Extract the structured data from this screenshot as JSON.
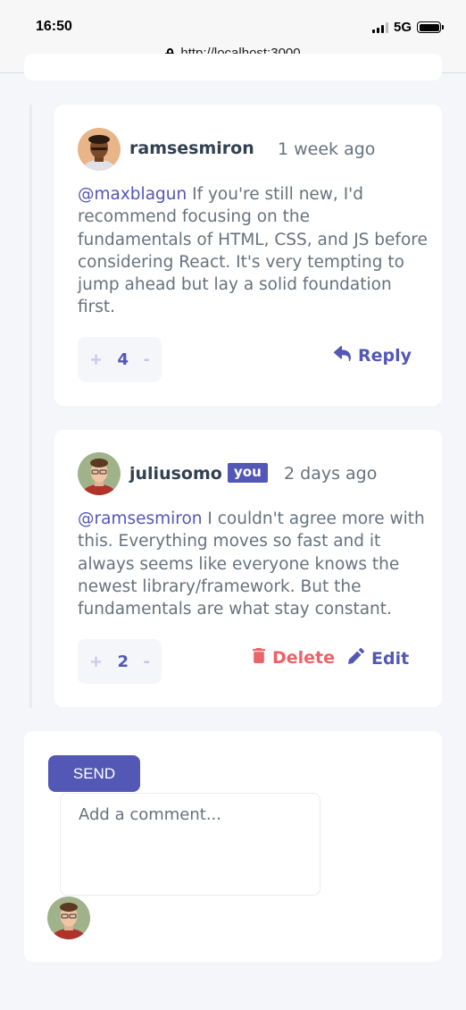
{
  "status_bar": {
    "time": "16:50",
    "network": "5G"
  },
  "browser": {
    "url": "http://localhost:3000"
  },
  "comments": [
    {
      "username": "ramsesmiron",
      "timestamp": "1 week ago",
      "mention": "@maxblagun",
      "text": " If you're still new, I'd recommend focusing on the fundamentals of HTML, CSS, and JS before considering React. It's very tempting to jump ahead but lay a solid foundation first.",
      "score": "4",
      "plus": "+",
      "minus": "-",
      "action_label": "Reply"
    },
    {
      "username": "juliusomo",
      "badge": "you",
      "timestamp": "2 days ago",
      "mention": "@ramsesmiron",
      "text": " I couldn't agree more with this. Everything moves so fast and it always seems like everyone knows the newest library/framework. But the fundamentals are what stay constant.",
      "score": "2",
      "plus": "+",
      "minus": "-",
      "delete_label": "Delete",
      "edit_label": "Edit"
    }
  ],
  "compose": {
    "send_label": "SEND",
    "placeholder": "Add a comment..."
  },
  "icons": {
    "reply": "reply-icon",
    "delete": "trash-icon",
    "edit": "pencil-icon"
  },
  "colors": {
    "accent": "#5357b6",
    "danger": "#ed6368",
    "text": "#67727e",
    "heading": "#324152",
    "background": "#f5f6fa"
  }
}
